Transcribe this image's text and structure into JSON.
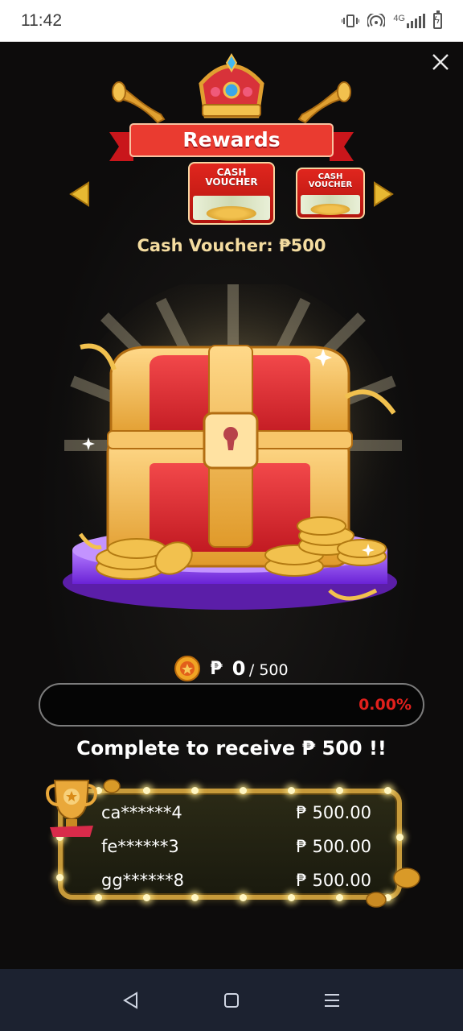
{
  "status_bar": {
    "time": "11:42",
    "icons": [
      "vibrate-icon",
      "hotspot-icon",
      "signal-icon",
      "battery-charging-icon"
    ],
    "network_label": "4G"
  },
  "header": {
    "title": "Rewards",
    "close_icon": "close-icon"
  },
  "carousel": {
    "prev_icon": "arrow-left-icon",
    "next_icon": "arrow-right-icon",
    "vouchers": [
      {
        "line1": "CASH",
        "line2": "VOUCHER",
        "selected": true
      },
      {
        "line1": "CASH",
        "line2": "VOUCHER",
        "selected": false
      }
    ],
    "selected_label": "Cash Voucher: ₱500"
  },
  "progress": {
    "currency": "₱",
    "current": "0",
    "target": "/ 500",
    "fraction": 0.0,
    "percent_text": "0.00%",
    "complete_text": "Complete to receive ₱ 500 !!"
  },
  "winners": [
    {
      "user": "ca******4",
      "amount": "₱ 500.00"
    },
    {
      "user": "fe******3",
      "amount": "₱ 500.00"
    },
    {
      "user": "gg******8",
      "amount": "₱ 500.00"
    }
  ],
  "colors": {
    "gold": "#f4dca0",
    "red": "#e0201c",
    "purple": "#8b3fe6",
    "background": "#0c0b0b"
  },
  "nav": {
    "back_icon": "back-triangle-icon",
    "home_icon": "home-square-icon",
    "menu_icon": "menu-lines-icon"
  }
}
